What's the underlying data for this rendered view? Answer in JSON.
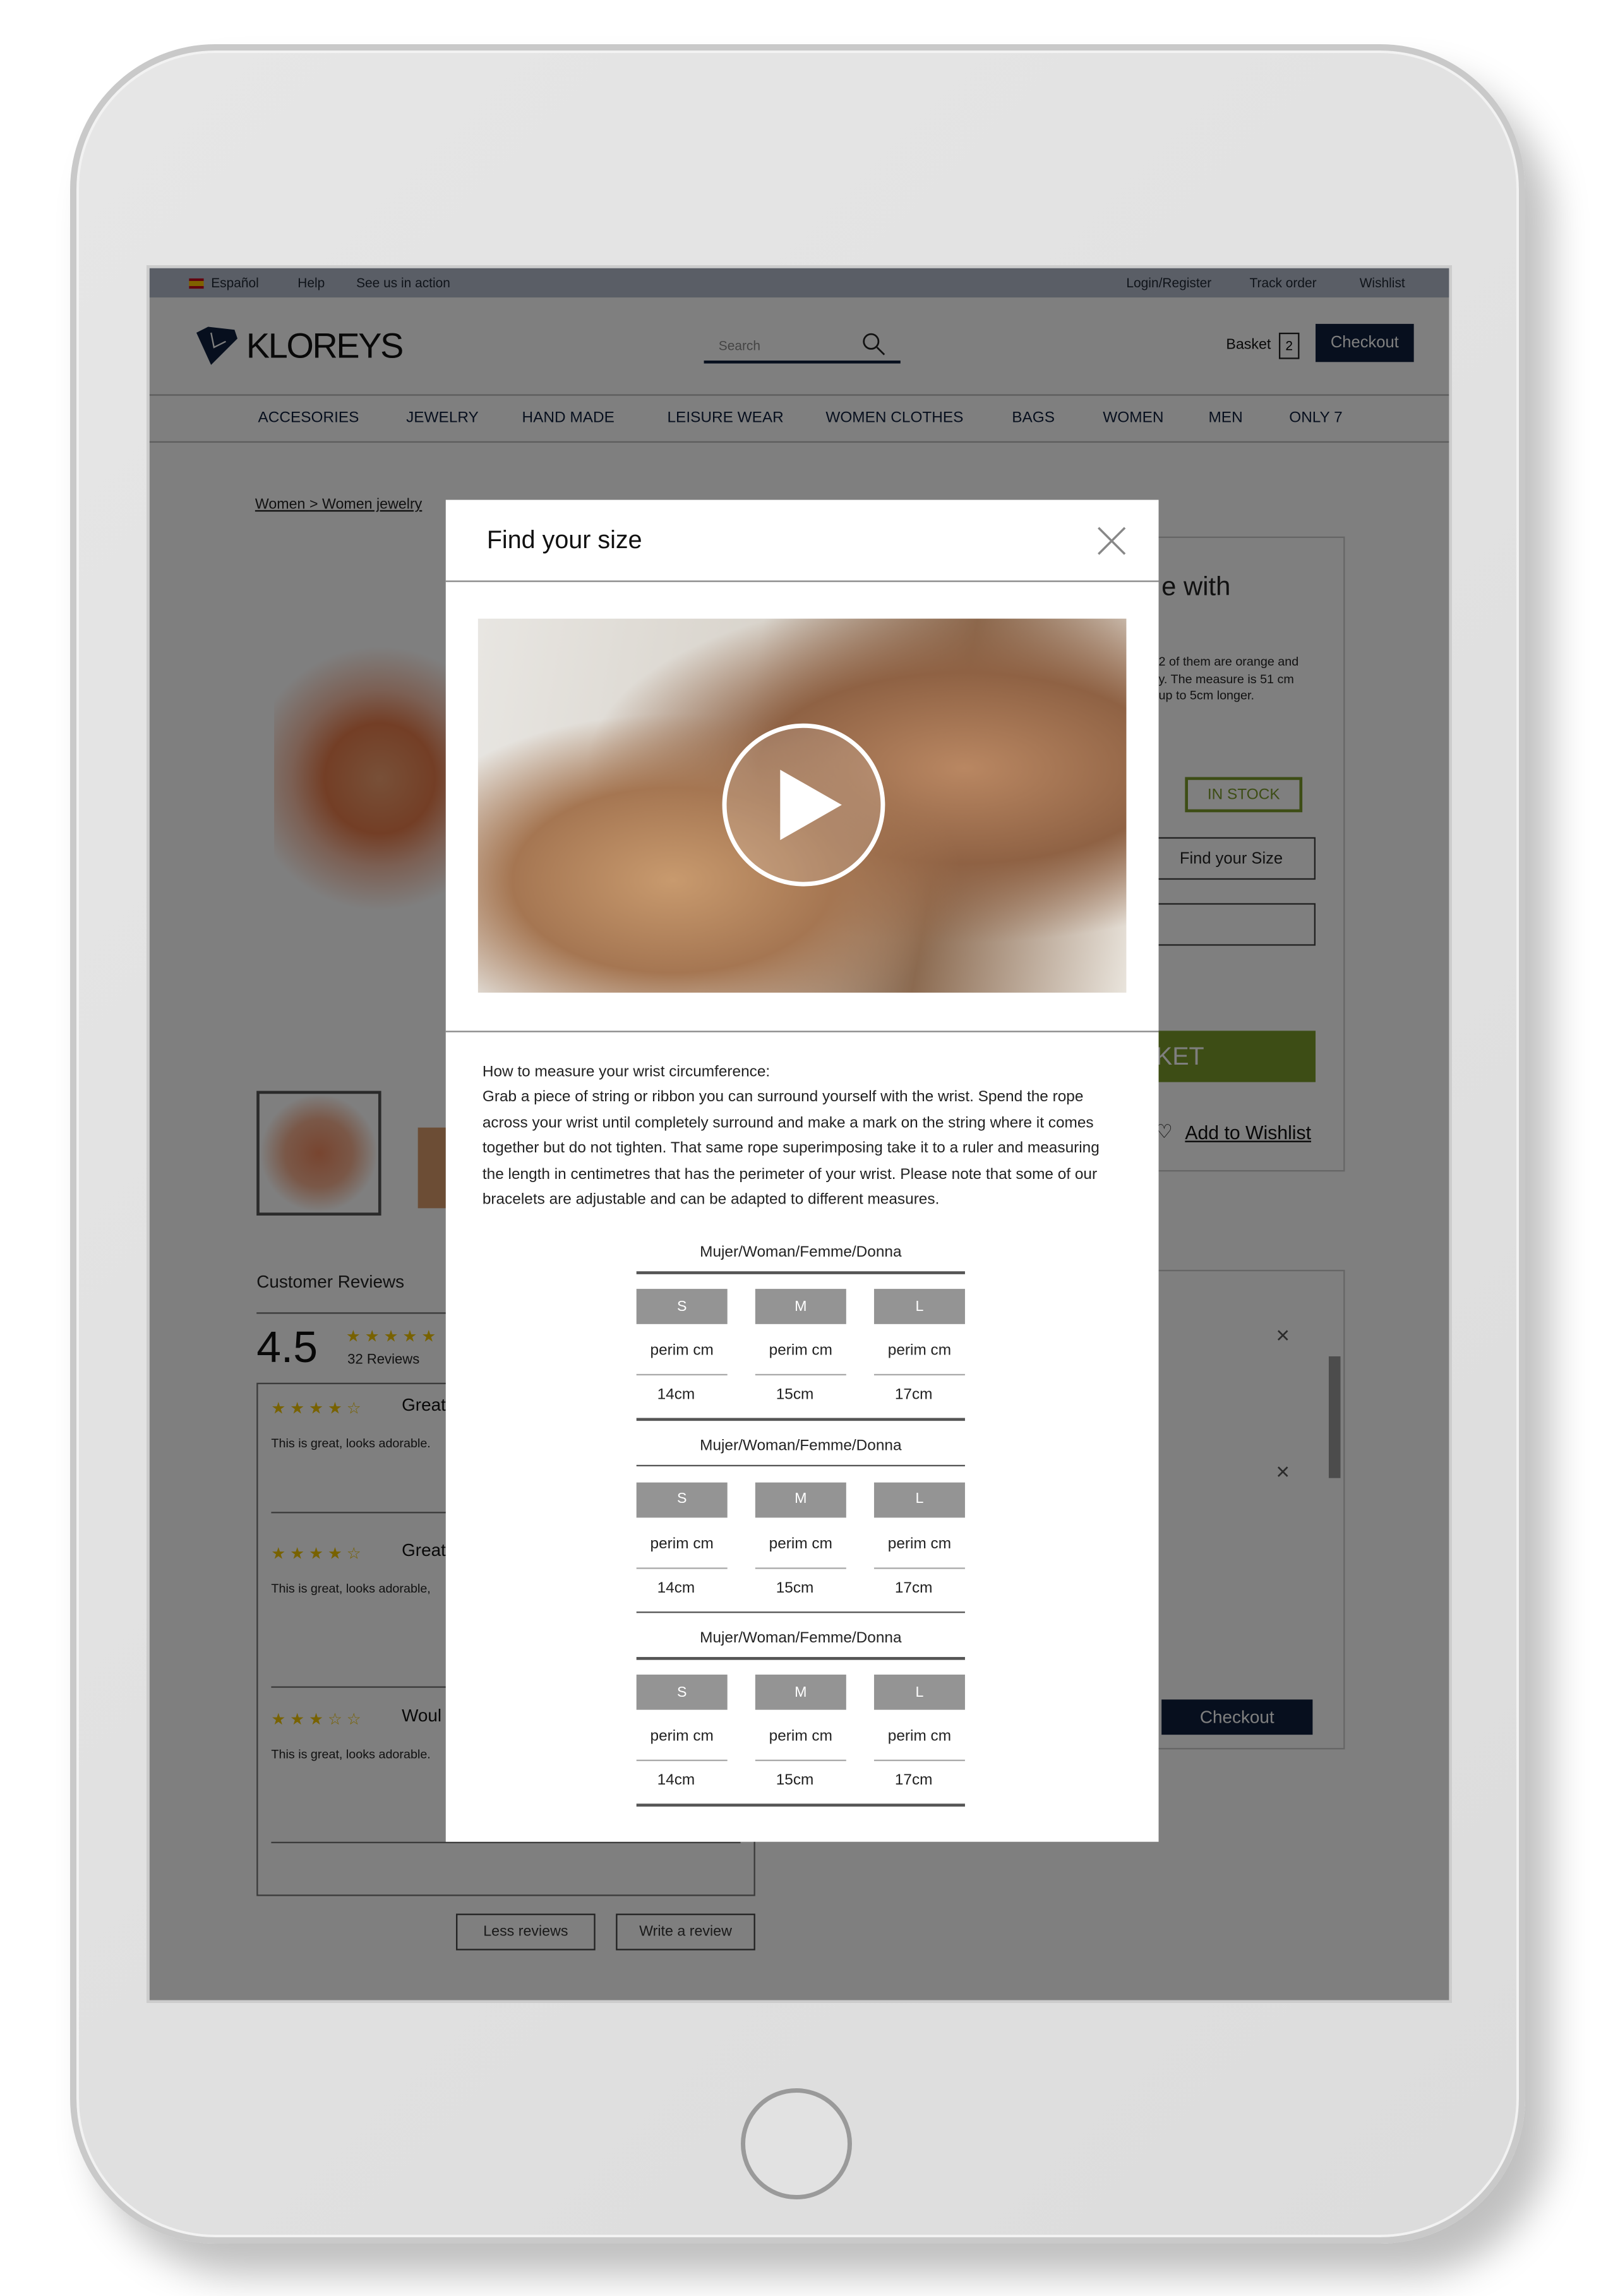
{
  "topbar": {
    "language": "Español",
    "help": "Help",
    "see_us": "See us in action",
    "login": "Login/Register",
    "track": "Track order",
    "wishlist": "Wishlist"
  },
  "header": {
    "logo": "KLOREYS",
    "search_placeholder": "Search",
    "basket": "Basket",
    "basket_count": "2",
    "checkout": "Checkout"
  },
  "nav": [
    "ACCESORIES",
    "JEWELRY",
    "HAND MADE",
    "LEISURE WEAR",
    "WOMEN CLOTHES",
    "BAGS",
    "WOMEN",
    "MEN",
    "ONLY 7"
  ],
  "breadcrumb": [
    "Women",
    ">",
    "Women jewelry"
  ],
  "product": {
    "title_fragment": "e with",
    "desc": [
      "2 of them are orange and",
      "y. The measure is 51 cm",
      "up to 5cm longer."
    ],
    "stock": "IN STOCK",
    "find_size": "Find your Size",
    "basket_button": "KET",
    "add_wishlist": "Add to Wishlist"
  },
  "reviews": {
    "heading": "Customer Reviews",
    "score": "4.5",
    "count": "32 Reviews",
    "items": [
      {
        "stars": 4,
        "title": "Great",
        "text": "This is great, looks adorable."
      },
      {
        "stars": 4,
        "title": "Great",
        "text": "This is great, looks adorable,"
      },
      {
        "stars": 3,
        "title": "Woul",
        "text": "This is great, looks adorable."
      }
    ],
    "less": "Less reviews",
    "write": "Write a review"
  },
  "cart": {
    "checkout": "Checkout"
  },
  "modal": {
    "title": "Find your size",
    "intro": "How to measure your wrist circumference:",
    "body": "Grab a piece of string or ribbon you can surround yourself with the wrist. Spend the rope across your wrist until completely surround and make a mark on the string where it comes together but do not tighten. That same rope superimposing take it to a ruler and measuring the length in centimetres that has the perimeter of your wrist. Please note that some of our bracelets are adjustable and can be adapted to different measures.",
    "tables": [
      {
        "heading": "Mujer/Woman/Femme/Donna",
        "sizes": [
          "S",
          "M",
          "L"
        ],
        "labels": [
          "perim cm",
          "perim cm",
          "perim cm"
        ],
        "values": [
          "14cm",
          "15cm",
          "17cm"
        ]
      },
      {
        "heading": "Mujer/Woman/Femme/Donna",
        "sizes": [
          "S",
          "M",
          "L"
        ],
        "labels": [
          "perim cm",
          "perim cm",
          "perim cm"
        ],
        "values": [
          "14cm",
          "15cm",
          "17cm"
        ]
      },
      {
        "heading": "Mujer/Woman/Femme/Donna",
        "sizes": [
          "S",
          "M",
          "L"
        ],
        "labels": [
          "perim cm",
          "perim cm",
          "perim cm"
        ],
        "values": [
          "14cm",
          "15cm",
          "17cm"
        ]
      }
    ]
  },
  "colors": {
    "navy": "#0f1f3c",
    "green": "#7a9a2a",
    "star": "#f0c400",
    "size_box": "#949494"
  }
}
